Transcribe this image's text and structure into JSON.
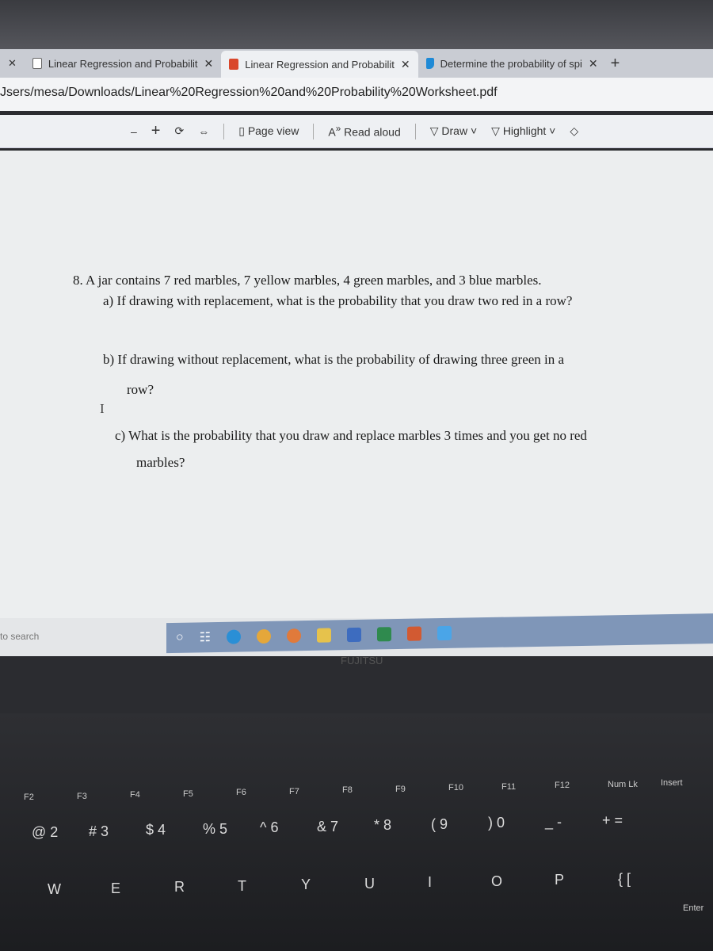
{
  "tabs": [
    {
      "label": "Linear Regression and Probabilit",
      "icon": "document-icon"
    },
    {
      "label": "Linear Regression and Probabilit",
      "icon": "pdf-icon",
      "active": true
    },
    {
      "label": "Determine the probability of spi",
      "icon": "bing-icon"
    }
  ],
  "address": "Jsers/mesa/Downloads/Linear%20Regression%20and%20Probability%20Worksheet.pdf",
  "toolbar": {
    "zoom_out": "–",
    "zoom_in": "+",
    "page_view": "Page view",
    "read_aloud": "Read aloud",
    "draw": "Draw",
    "highlight": "Highlight"
  },
  "question": {
    "stem": "8.  A jar contains 7 red marbles, 7 yellow marbles, 4 green marbles, and 3 blue marbles.",
    "a": "a)  If drawing with replacement, what is the probability that you draw two red in a row?",
    "b1": "b)  If drawing without replacement, what is the probability of drawing three green in a",
    "b2": "row?",
    "c1": "c)  What is the probability that you draw and replace marbles 3 times and you get no red",
    "c2": "marbles?"
  },
  "taskbar": {
    "search": "to search",
    "brand": "FUJITSU"
  },
  "keyboard": {
    "fkeys": [
      "F2",
      "F3",
      "F4",
      "F5",
      "F6",
      "F7",
      "F8",
      "F9",
      "F10",
      "F11",
      "F12",
      "Num Lk",
      "Insert"
    ],
    "numbers": [
      "@ 2",
      "# 3",
      "$ 4",
      "% 5",
      "^ 6",
      "& 7",
      "* 8",
      "( 9",
      ") 0",
      "_ -",
      "+ ="
    ],
    "letters": [
      "W",
      "E",
      "R",
      "T",
      "Y",
      "U",
      "I",
      "O",
      "P",
      "{ ["
    ],
    "enter": "Enter"
  }
}
